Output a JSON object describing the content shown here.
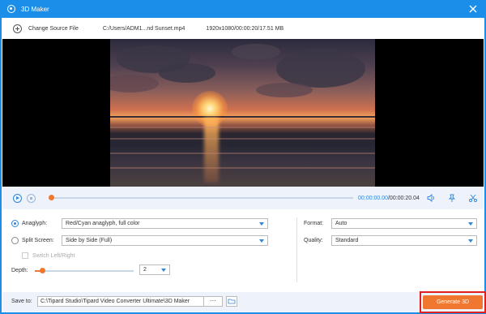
{
  "window": {
    "title": "3D Maker"
  },
  "toolbar": {
    "change_source_label": "Change Source File",
    "file_path": "C:/Users/ADM1...nd Sunset.mp4",
    "file_info": "1920x1080/00:00:20/17.51 MB"
  },
  "player": {
    "current_time": "00:00:00.00",
    "total_time": "/00:00:20.04",
    "progress": 0.0
  },
  "settings": {
    "anaglyph_label": "Anaglyph:",
    "anaglyph_value": "Red/Cyan anaglyph, full color",
    "split_screen_label": "Split Screen:",
    "split_screen_value": "Side by Side (Full)",
    "switch_label": "Switch Left/Right",
    "depth_label": "Depth:",
    "depth_value": "2",
    "depth_slider_fraction": 0.07,
    "format_label": "Format:",
    "format_value": "Auto",
    "quality_label": "Quality:",
    "quality_value": "Standard",
    "selected_mode": "anaglyph"
  },
  "bottom": {
    "save_to_label": "Save to:",
    "save_path": "C:\\Tipard Studio\\Tipard Video Converter Ultimate\\3D Maker",
    "browse_label": "···",
    "generate_label": "Generate 3D"
  },
  "colors": {
    "accent": "#1a8ee8",
    "orange": "#f0772f",
    "highlight": "#e02020"
  }
}
